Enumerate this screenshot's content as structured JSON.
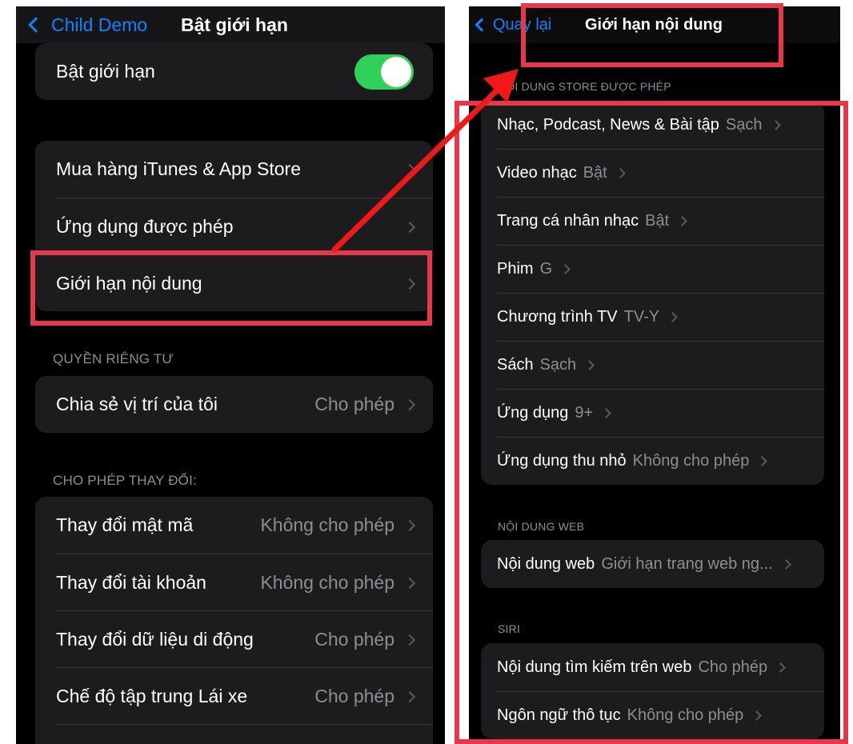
{
  "left": {
    "nav": {
      "back_label": "Child Demo",
      "title": "Bật giới hạn"
    },
    "toggle_row": {
      "label": "Bật giới hạn",
      "toggle_on": true
    },
    "group_main": [
      {
        "label": "Mua hàng iTunes & App Store"
      },
      {
        "label": "Ứng dụng được phép"
      },
      {
        "label": "Giới hạn nội dung"
      }
    ],
    "privacy": {
      "header": "QUYỀN RIÊNG TƯ",
      "rows": [
        {
          "label": "Chia sẻ vị trí của tôi",
          "value": "Cho phép"
        }
      ]
    },
    "changes": {
      "header": "CHO PHÉP THAY ĐỔI:",
      "rows": [
        {
          "label": "Thay đổi mật mã",
          "value": "Không cho phép"
        },
        {
          "label": "Thay đổi tài khoản",
          "value": "Không cho phép"
        },
        {
          "label": "Thay đổi dữ liệu di động",
          "value": "Cho phép"
        },
        {
          "label": "Chế độ tập trung Lái xe",
          "value": "Cho phép"
        }
      ]
    }
  },
  "right": {
    "nav": {
      "back_label": "Quay lại",
      "title": "Giới hạn nội dung"
    },
    "store": {
      "header": "NỘI DUNG STORE ĐƯỢC PHÉP",
      "rows": [
        {
          "label": "Nhạc, Podcast, News & Bài tập",
          "value": "Sạch"
        },
        {
          "label": "Video nhạc",
          "value": "Bật"
        },
        {
          "label": "Trang cá nhân nhạc",
          "value": "Bật"
        },
        {
          "label": "Phim",
          "value": "G"
        },
        {
          "label": "Chương trình TV",
          "value": "TV-Y"
        },
        {
          "label": "Sách",
          "value": "Sạch"
        },
        {
          "label": "Ứng dụng",
          "value": "9+"
        },
        {
          "label": "Ứng dụng thu nhỏ",
          "value": "Không cho phép"
        }
      ]
    },
    "web": {
      "header": "NỘI DUNG WEB",
      "rows": [
        {
          "label": "Nội dung web",
          "value": "Giới hạn trang web ng..."
        }
      ]
    },
    "siri": {
      "header": "SIRI",
      "rows": [
        {
          "label": "Nội dung tìm kiếm trên web",
          "value": "Cho phép"
        },
        {
          "label": "Ngôn ngữ thô tục",
          "value": "Không cho phép"
        }
      ]
    }
  },
  "colors": {
    "accent_blue": "#0a84ff",
    "toggle_green": "#30d158",
    "highlight_red": "#e8364a",
    "cell_bg": "#1c1c1e",
    "secondary_text": "#8d8d93"
  }
}
